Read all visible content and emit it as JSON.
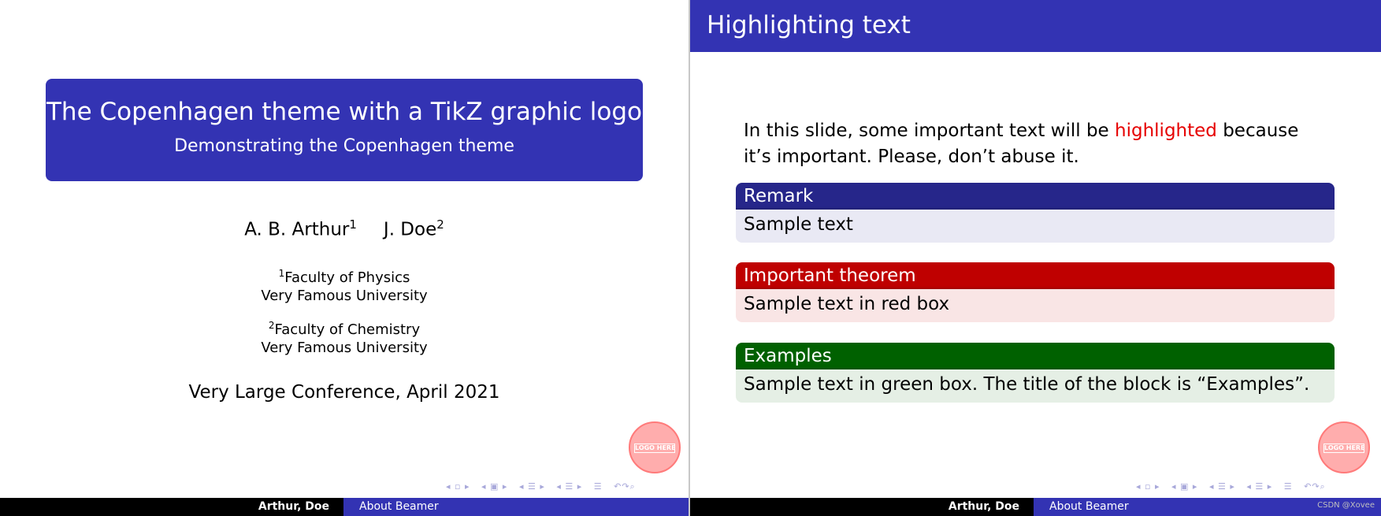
{
  "title_slide": {
    "title": "The Copenhagen theme with a TikZ graphic logo",
    "subtitle": "Demonstrating the Copenhagen theme",
    "author_1": "A. B. Arthur",
    "author_1_mark": "1",
    "author_2": "J. Doe",
    "author_2_mark": "2",
    "affiliation_1_mark": "1",
    "affiliation_1_line1": "Faculty of Physics",
    "affiliation_1_line2": "Very Famous University",
    "affiliation_2_mark": "2",
    "affiliation_2_line1": "Faculty of Chemistry",
    "affiliation_2_line2": "Very Famous University",
    "conference": "Very Large Conference, April 2021"
  },
  "content_slide": {
    "frame_title": "Highlighting text",
    "paragraph_before": "In this slide, some important text will be ",
    "paragraph_highlight": "highlighted",
    "paragraph_after": " because it’s important. Please, don’t abuse it.",
    "blocks": [
      {
        "title": "Remark",
        "body": "Sample text"
      },
      {
        "title": "Important theorem",
        "body": "Sample text in red box"
      },
      {
        "title": "Examples",
        "body": "Sample text in green box. The title of the block is “Examples”."
      }
    ]
  },
  "logo": {
    "label": "LOGO HERE"
  },
  "footline": {
    "author": "Arthur, Doe",
    "short_title": "About Beamer"
  },
  "watermark": "CSDN @Xovee",
  "colors": {
    "structure": "#3333b3",
    "alert": "#e60000",
    "alert_block": "#bf0000",
    "example_block": "#006100",
    "remark_block": "#26268a"
  },
  "icons": [
    "nav-frame-icon",
    "nav-subsection-icon",
    "nav-section-icon",
    "nav-doc-icon",
    "nav-search-icon"
  ]
}
